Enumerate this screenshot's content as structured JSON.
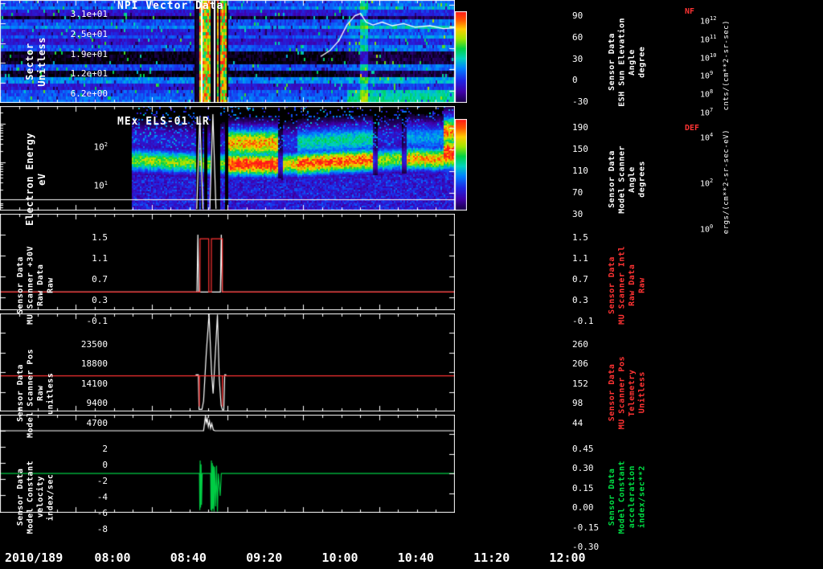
{
  "x_axis": {
    "date_label": "2010/189",
    "range": [
      8,
      12
    ],
    "ticks": [
      {
        "t": 8,
        "label": "08:00"
      },
      {
        "t": 8.6667,
        "label": "08:40"
      },
      {
        "t": 9.3333,
        "label": "09:20"
      },
      {
        "t": 10,
        "label": "10:00"
      },
      {
        "t": 10.6667,
        "label": "10:40"
      },
      {
        "t": 11.3333,
        "label": "11:20"
      },
      {
        "t": 12,
        "label": "12:00"
      }
    ]
  },
  "chart_data": [
    {
      "id": "npi-vector",
      "type": "heatmap",
      "title": "NPI Vector Data",
      "left_label": "Sector\nUnitless",
      "left_ylim": [
        0,
        32
      ],
      "left_ticks": [
        {
          "v": 31,
          "label": "3.1e+01"
        },
        {
          "v": 24.8,
          "label": "2.5e+01"
        },
        {
          "v": 18.6,
          "label": "1.9e+01"
        },
        {
          "v": 12.4,
          "label": "1.2e+01"
        },
        {
          "v": 6.2,
          "label": "6.2e+00"
        }
      ],
      "right_label": "Sensor Data\nESH Sun Elevation\nAngle\ndegree",
      "right_ylim": [
        -47,
        97
      ],
      "right_ticks": [
        {
          "v": 90,
          "label": "90"
        },
        {
          "v": 60,
          "label": "60"
        },
        {
          "v": 30,
          "label": "30"
        },
        {
          "v": 0,
          "label": "0"
        },
        {
          "v": -30,
          "label": "-30"
        }
      ],
      "colorbar": {
        "name": "NF",
        "unit": "cnts/(cm**2-sr-sec)",
        "tick_exps": [
          "12",
          "11",
          "10",
          "9",
          "8",
          "7"
        ]
      },
      "heat": {
        "kind": "npi",
        "description": "32-sector neutral particle count-rate spectrogram 08:00-12:00; mostly blue/purple rows with black sector bands; burst of saturated green/red/yellow stripes 09:43-10:00 bounded by black gaps; brighter cyan region after 11:05",
        "pulse": [
          9.715,
          10.01
        ]
      },
      "overlay": {
        "axis": "right",
        "color": "#ffffff",
        "points": [
          [
            10.82,
            18
          ],
          [
            10.9,
            26
          ],
          [
            10.98,
            40
          ],
          [
            11.05,
            62
          ],
          [
            11.12,
            75
          ],
          [
            11.17,
            78
          ],
          [
            11.22,
            66
          ],
          [
            11.28,
            62
          ],
          [
            11.36,
            66
          ],
          [
            11.45,
            61
          ],
          [
            11.55,
            64
          ],
          [
            11.65,
            59
          ],
          [
            11.78,
            61
          ],
          [
            11.9,
            57
          ],
          [
            12,
            58
          ]
        ]
      }
    },
    {
      "id": "els",
      "type": "heatmap",
      "title": "MEx ELS-01 LR",
      "left_label": "Electron Energy\neV",
      "left_log": true,
      "left_ylim": [
        -0.24,
        2.46
      ],
      "left_ticks": [
        {
          "v": 2,
          "exp": "2"
        },
        {
          "v": 1,
          "exp": "1"
        }
      ],
      "right_label": "Sensor Data\nModel Scanner\nAngle\ndegrees",
      "right_ylim": [
        -3,
        190
      ],
      "right_ticks": [
        {
          "v": 190,
          "label": "190"
        },
        {
          "v": 150,
          "label": "150"
        },
        {
          "v": 110,
          "label": "110"
        },
        {
          "v": 70,
          "label": "70"
        },
        {
          "v": 30,
          "label": "30"
        }
      ],
      "colorbar": {
        "name": "DEF",
        "unit": "ergs/(cm**2-sr-sec-eV)",
        "tick_exps": [
          "4",
          "2",
          "0"
        ]
      },
      "heat": {
        "kind": "els",
        "description": "electron energy spectrogram, data starts 09:10; intense 10-30 eV band from green to red; red blobs 10:00-10:30, 10:40-11:15 and 11:55-12:00; vertical data dropouts 09:43-10:00 with thin white spikes",
        "data_start": 9.165,
        "pulse": [
          9.72,
          10.0
        ]
      },
      "baseline": {
        "axis": "left",
        "value": 0.06,
        "color": "#ffffff"
      },
      "white_spikes": [
        [
          [
            9.73,
            -0.2
          ],
          [
            9.757,
            2.2
          ],
          [
            9.784,
            -0.2
          ]
        ],
        [
          [
            9.845,
            -0.2
          ],
          [
            9.872,
            2.25
          ],
          [
            9.899,
            -0.2
          ]
        ]
      ]
    },
    {
      "id": "mu-scanner-30v",
      "type": "line",
      "left_label": "Sensor Data\nMU Scanner +30V\nRaw Data\nRaw",
      "left_ylim": [
        -0.35,
        1.5
      ],
      "left_ticks": [
        {
          "v": 1.5,
          "label": "1.5"
        },
        {
          "v": 1.1,
          "label": "1.1"
        },
        {
          "v": 0.7,
          "label": "0.7"
        },
        {
          "v": 0.3,
          "label": "0.3"
        },
        {
          "v": -0.1,
          "label": "-0.1"
        }
      ],
      "right_label": "Sensor Data\nMU Scanner Intl\nRaw Data\nRaw",
      "right_color": "#ff3333",
      "right_ylim": [
        -0.35,
        1.5
      ],
      "right_ticks": [
        {
          "v": 1.5,
          "label": "1.5"
        },
        {
          "v": 1.1,
          "label": "1.1"
        },
        {
          "v": 0.7,
          "label": "0.7"
        },
        {
          "v": 0.3,
          "label": "0.3"
        },
        {
          "v": -0.1,
          "label": "-0.1"
        }
      ],
      "series": [
        {
          "name": "scanner-30v-raw",
          "color": "#ffffff",
          "axis": "left",
          "points": [
            [
              8,
              0
            ],
            [
              9.732,
              0
            ],
            [
              9.74,
              1.1
            ],
            [
              9.748,
              0
            ],
            [
              9.938,
              0
            ],
            [
              9.946,
              1.1
            ],
            [
              9.954,
              0
            ],
            [
              12,
              0
            ]
          ]
        },
        {
          "name": "mu-scanner-intl-raw",
          "color": "#ff3333",
          "axis": "right",
          "points": [
            [
              8,
              0
            ],
            [
              9.758,
              0
            ],
            [
              9.759,
              1.02
            ],
            [
              9.835,
              1.02
            ],
            [
              9.836,
              0
            ],
            [
              9.858,
              0
            ],
            [
              9.859,
              1.02
            ],
            [
              9.955,
              1.02
            ],
            [
              9.956,
              0
            ],
            [
              12,
              0
            ]
          ]
        }
      ]
    },
    {
      "id": "scanner-pos",
      "type": "line",
      "left_label": "Sensor Data\nModel Scanner Pos\nRaw\nunitless",
      "left_ylim": [
        0,
        23500
      ],
      "left_ticks": [
        {
          "v": 23500,
          "label": "23500"
        },
        {
          "v": 18800,
          "label": "18800"
        },
        {
          "v": 14100,
          "label": "14100"
        },
        {
          "v": 9400,
          "label": "9400"
        },
        {
          "v": 4700,
          "label": "4700"
        }
      ],
      "right_label": "Sensor Data\nMU Scanner Pos\nTelemetry\nUnitless",
      "right_color": "#ff3333",
      "right_ylim": [
        -10,
        260
      ],
      "right_ticks": [
        {
          "v": 260,
          "label": "260"
        },
        {
          "v": 206,
          "label": "206"
        },
        {
          "v": 152,
          "label": "152"
        },
        {
          "v": 98,
          "label": "98"
        },
        {
          "v": 44,
          "label": "44"
        }
      ],
      "series": [
        {
          "name": "model-scanner-pos",
          "color": "#ffffff",
          "axis": "left",
          "points": [
            [
              9.72,
              8800
            ],
            [
              9.744,
              8800
            ],
            [
              9.75,
              500
            ],
            [
              9.776,
              500
            ],
            [
              9.79,
              2500
            ],
            [
              9.814,
              14000
            ],
            [
              9.838,
              23350
            ],
            [
              9.86,
              9500
            ],
            [
              9.874,
              4300
            ],
            [
              9.894,
              14000
            ],
            [
              9.912,
              23200
            ],
            [
              9.928,
              8000
            ],
            [
              9.944,
              1500
            ],
            [
              9.956,
              400
            ],
            [
              9.968,
              400
            ],
            [
              9.976,
              8800
            ],
            [
              9.99,
              8800
            ]
          ]
        },
        {
          "name": "mu-scanner-pos-telemetry",
          "color": "#ff3333",
          "axis": "right",
          "points": [
            [
              8,
              88
            ],
            [
              9.752,
              88
            ],
            [
              9.753,
              4
            ],
            [
              9.754,
              88
            ],
            [
              9.955,
              88
            ],
            [
              9.956,
              4
            ],
            [
              9.957,
              88
            ],
            [
              12,
              88
            ]
          ]
        }
      ]
    },
    {
      "id": "model-constant",
      "type": "line",
      "left_label": "Sensor Data\nModel Constant\nvelocity\nindex/sec",
      "left_ylim": [
        -10.2,
        2
      ],
      "left_ticks": [
        {
          "v": 2,
          "label": "2"
        },
        {
          "v": 0,
          "label": "0"
        },
        {
          "v": -2,
          "label": "-2"
        },
        {
          "v": -4,
          "label": "-4"
        },
        {
          "v": -6,
          "label": "-6"
        },
        {
          "v": -8,
          "label": "-8"
        }
      ],
      "right_label": "Sensor Data\nModel Constant\nacceleration\nindex/sec**2",
      "right_color": "#00dd44",
      "right_ylim": [
        -0.3,
        0.45
      ],
      "right_ticks": [
        {
          "v": 0.45,
          "label": "0.45"
        },
        {
          "v": 0.3,
          "label": "0.30"
        },
        {
          "v": 0.15,
          "label": "0.15"
        },
        {
          "v": 0,
          "label": "0.00"
        },
        {
          "v": -0.15,
          "label": "-0.15"
        },
        {
          "v": -0.3,
          "label": "-0.30"
        }
      ],
      "series": [
        {
          "name": "model-constant-velocity",
          "color": "#ffffff",
          "axis": "left",
          "points": [
            [
              8,
              0
            ],
            [
              9.79,
              0
            ],
            [
              9.798,
              0.85
            ],
            [
              9.806,
              1.8
            ],
            [
              9.814,
              1.0
            ],
            [
              9.822,
              1.55
            ],
            [
              9.832,
              0.5
            ],
            [
              9.842,
              1.2
            ],
            [
              9.852,
              0.3
            ],
            [
              9.862,
              0.9
            ],
            [
              9.876,
              0.1
            ],
            [
              9.89,
              0
            ],
            [
              12,
              0
            ]
          ]
        },
        {
          "name": "model-constant-acceleration",
          "color": "#00cc44",
          "axis": "right",
          "points": [
            [
              8,
              0
            ],
            [
              9.754,
              0
            ],
            [
              9.757,
              -0.28
            ],
            [
              9.76,
              0.1
            ],
            [
              9.764,
              -0.26
            ],
            [
              9.768,
              0.07
            ],
            [
              9.772,
              -0.24
            ],
            [
              9.778,
              0
            ],
            [
              9.852,
              0
            ],
            [
              9.855,
              -0.28
            ],
            [
              9.859,
              0.1
            ],
            [
              9.863,
              -0.29
            ],
            [
              9.867,
              0.08
            ],
            [
              9.872,
              -0.27
            ],
            [
              9.877,
              0.06
            ],
            [
              9.882,
              -0.29
            ],
            [
              9.887,
              0.05
            ],
            [
              9.896,
              -0.25
            ],
            [
              9.904,
              0.06
            ],
            [
              9.912,
              -0.29
            ],
            [
              9.92,
              0
            ],
            [
              9.936,
              -0.17
            ],
            [
              9.946,
              0
            ],
            [
              12,
              0
            ]
          ]
        }
      ]
    }
  ],
  "colors": {
    "background": "#000000",
    "foreground": "#ffffff",
    "red_label": "#ff3333",
    "green_label": "#00dd44"
  }
}
